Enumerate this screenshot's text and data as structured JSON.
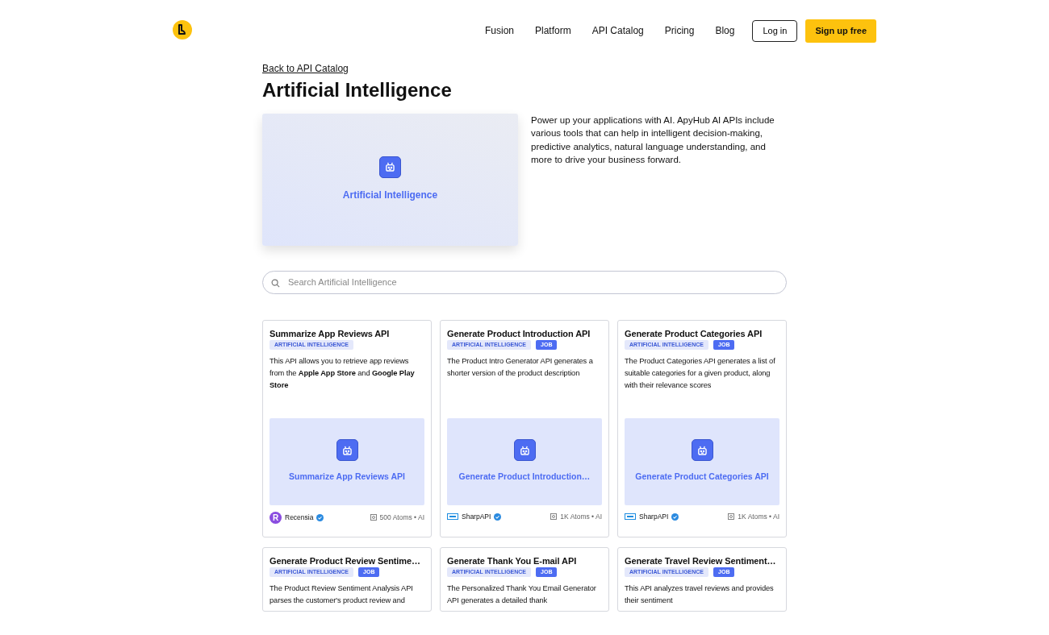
{
  "nav": {
    "links": [
      "Fusion",
      "Platform",
      "API Catalog",
      "Pricing",
      "Blog"
    ],
    "login": "Log in",
    "signup": "Sign up free"
  },
  "back_link": "Back to API Catalog",
  "title": "Artificial Intelligence",
  "hero": {
    "label": "Artificial Intelligence",
    "description": "Power up your applications with AI. ApyHub AI APIs include various tools that can help in intelligent decision-making, predictive analytics, natural language understanding, and more to drive your business forward."
  },
  "search": {
    "placeholder": "Search Artificial Intelligence"
  },
  "cards": [
    {
      "title": "Summarize App Reviews API",
      "tags": [
        {
          "label": "ARTIFICIAL INTELLIGENCE",
          "kind": "category"
        }
      ],
      "description": "This API allows you to retrieve app reviews from the **Apple App Store** and **Google Play Store**",
      "image_label": "Summarize App Reviews API",
      "provider": {
        "name": "Recensia",
        "logo_letter": "R"
      },
      "usage": "500 Atoms • AI"
    },
    {
      "title": "Generate Product Introduction API",
      "tags": [
        {
          "label": "ARTIFICIAL INTELLIGENCE",
          "kind": "category"
        },
        {
          "label": "JOB",
          "kind": "job"
        }
      ],
      "description": "The Product Intro Generator API generates a shorter version of the product description",
      "image_label": "Generate Product Introduction…",
      "provider": {
        "name": "SharpAPI"
      },
      "usage": "1K Atoms • AI"
    },
    {
      "title": "Generate Product Categories API",
      "tags": [
        {
          "label": "ARTIFICIAL INTELLIGENCE",
          "kind": "category"
        },
        {
          "label": "JOB",
          "kind": "job"
        }
      ],
      "description": "The Product Categories API generates a list of suitable categories for a given product, along with their relevance scores",
      "image_label": "Generate Product Categories API",
      "provider": {
        "name": "SharpAPI"
      },
      "usage": "1K Atoms • AI"
    },
    {
      "title": "Generate Product Review Sentime…",
      "tags": [
        {
          "label": "ARTIFICIAL INTELLIGENCE",
          "kind": "category"
        },
        {
          "label": "JOB",
          "kind": "job"
        }
      ],
      "description": "The Product Review Sentiment Analysis API parses the customer's product review and"
    },
    {
      "title": "Generate Thank You E-mail API",
      "tags": [
        {
          "label": "ARTIFICIAL INTELLIGENCE",
          "kind": "category"
        },
        {
          "label": "JOB",
          "kind": "job"
        }
      ],
      "description": "The Personalized Thank You Email Generator API generates a detailed thank"
    },
    {
      "title": "Generate Travel Review Sentiment…",
      "tags": [
        {
          "label": "ARTIFICIAL INTELLIGENCE",
          "kind": "category"
        },
        {
          "label": "JOB",
          "kind": "job"
        }
      ],
      "description": "This API analyzes travel reviews and provides their sentiment"
    }
  ]
}
